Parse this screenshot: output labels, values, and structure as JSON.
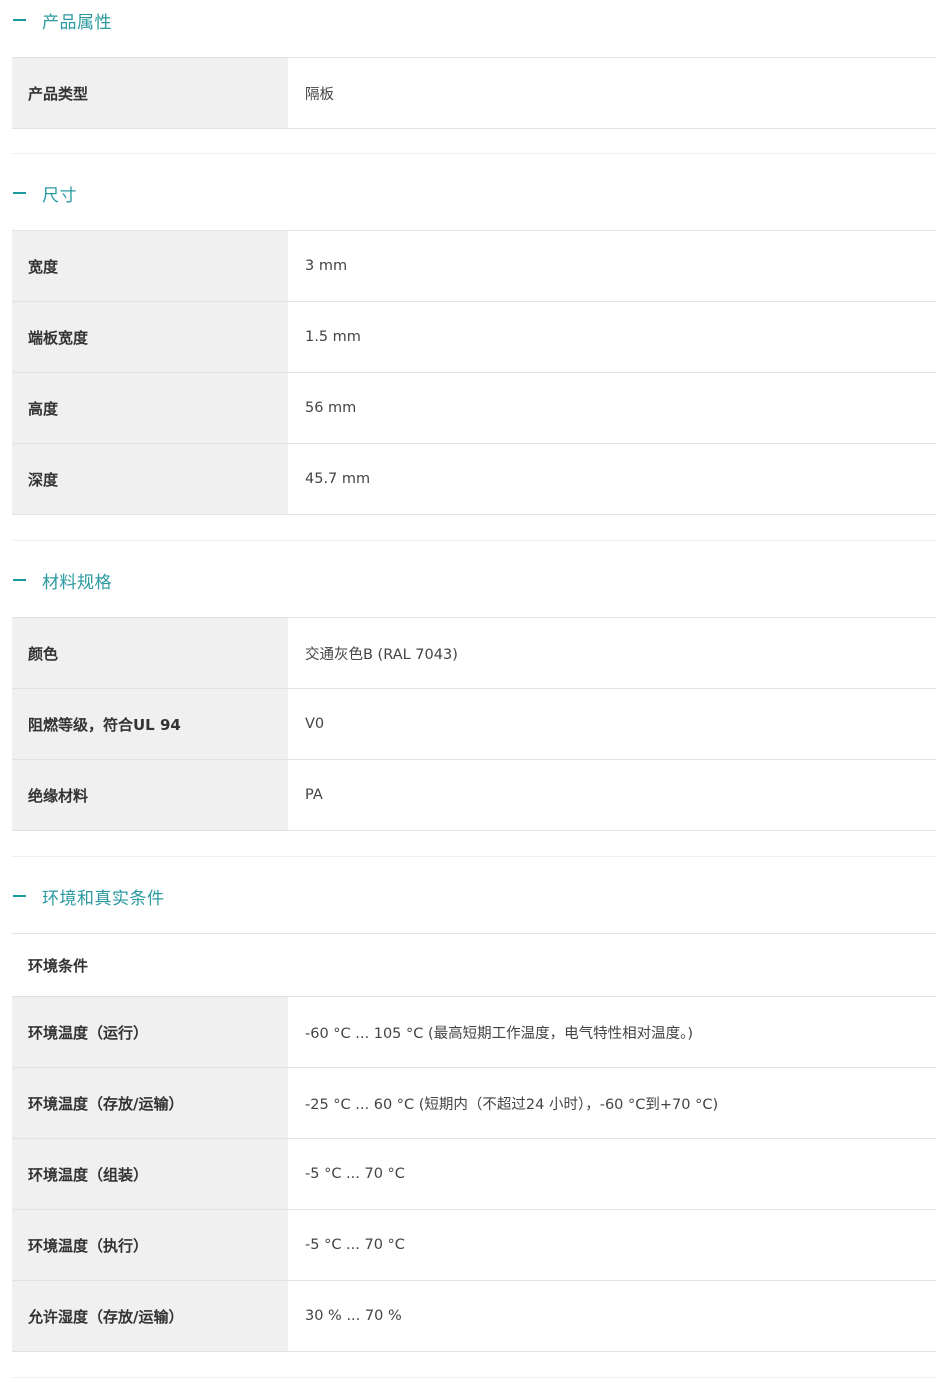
{
  "sections": [
    {
      "title": "产品属性",
      "rows": [
        {
          "label": "产品类型",
          "value": "隔板"
        }
      ]
    },
    {
      "title": "尺寸",
      "rows": [
        {
          "label": "宽度",
          "value": "3 mm"
        },
        {
          "label": "端板宽度",
          "value": "1.5 mm"
        },
        {
          "label": "高度",
          "value": "56 mm"
        },
        {
          "label": "深度",
          "value": "45.7 mm"
        }
      ]
    },
    {
      "title": "材料规格",
      "rows": [
        {
          "label": "颜色",
          "value": "交通灰色B (RAL 7043)"
        },
        {
          "label": "阻燃等级，符合UL 94",
          "value": "V0"
        },
        {
          "label": "绝缘材料",
          "value": "PA"
        }
      ]
    },
    {
      "title": "环境和真实条件",
      "subheader": "环境条件",
      "rows": [
        {
          "label": "环境温度（运行）",
          "value": "-60 °C ... 105 °C (最高短期工作温度，电气特性相对温度。)"
        },
        {
          "label": "环境温度（存放/运输）",
          "value": "-25 °C ... 60 °C (短期内（不超过24  小时），-60 °C到+70 °C)"
        },
        {
          "label": "环境温度（组装）",
          "value": "-5 °C ... 70 °C"
        },
        {
          "label": "环境温度（执行）",
          "value": "-5 °C ... 70 °C"
        },
        {
          "label": "允许湿度（存放/运输）",
          "value": "30 % ... 70 %"
        }
      ]
    }
  ],
  "colors": {
    "accent": "#2a9aa0",
    "label_bg": "#f0f0f0",
    "border": "#e2e2e2"
  }
}
